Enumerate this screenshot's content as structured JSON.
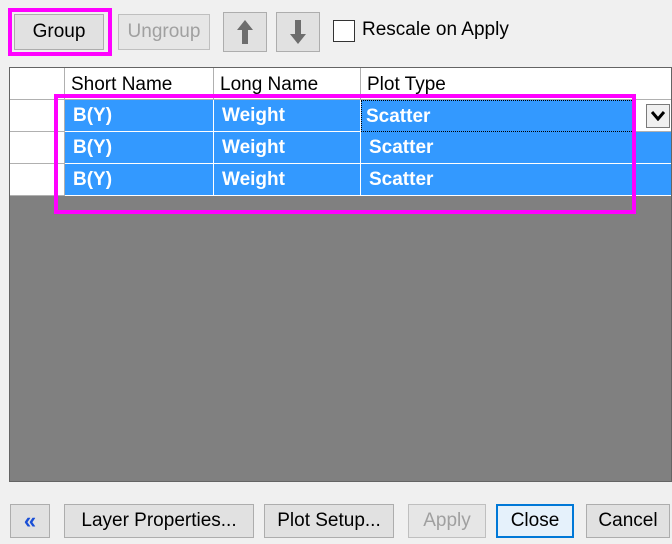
{
  "toolbar": {
    "group_label": "Group",
    "ungroup_label": "Ungroup",
    "up_icon": "arrow-up-icon",
    "down_icon": "arrow-down-icon",
    "rescale_label": "Rescale on Apply",
    "rescale_checked": false
  },
  "grid": {
    "columns": [
      "Short Name",
      "Long Name",
      "Plot Type"
    ],
    "rows": [
      {
        "short_name": "B(Y)",
        "long_name": "Weight",
        "plot_type": "Scatter"
      },
      {
        "short_name": "B(Y)",
        "long_name": "Weight",
        "plot_type": "Scatter"
      },
      {
        "short_name": "B(Y)",
        "long_name": "Weight",
        "plot_type": "Scatter"
      }
    ]
  },
  "footer": {
    "collapse_label": "«",
    "layer_properties_label": "Layer Properties...",
    "plot_setup_label": "Plot Setup...",
    "apply_label": "Apply",
    "close_label": "Close",
    "cancel_label": "Cancel"
  },
  "colors": {
    "selection": "#3399ff",
    "highlight": "#ff00ff",
    "grid_background": "#808080"
  }
}
